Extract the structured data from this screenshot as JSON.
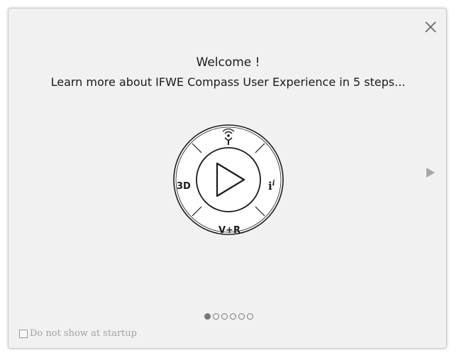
{
  "dialog": {
    "title": "Welcome !",
    "subtitle": "Learn more about IFWE Compass User Experience in 5 steps...",
    "close_icon": "close-icon",
    "next_icon": "play-arrow-icon"
  },
  "compass": {
    "label_left": "3D",
    "label_bottom": "V+R",
    "label_right": "i",
    "label_right_super": "i",
    "top_icon": "wifi-person-icon",
    "center_icon": "play-icon"
  },
  "pager": {
    "total": 6,
    "current": 1
  },
  "footer": {
    "startup_label": "Do not show at startup",
    "startup_checked": false
  },
  "colors": {
    "background": "#f1f1f1",
    "border": "#c9c9c9",
    "icon": "#555555",
    "muted_text": "#a2a2a2"
  }
}
